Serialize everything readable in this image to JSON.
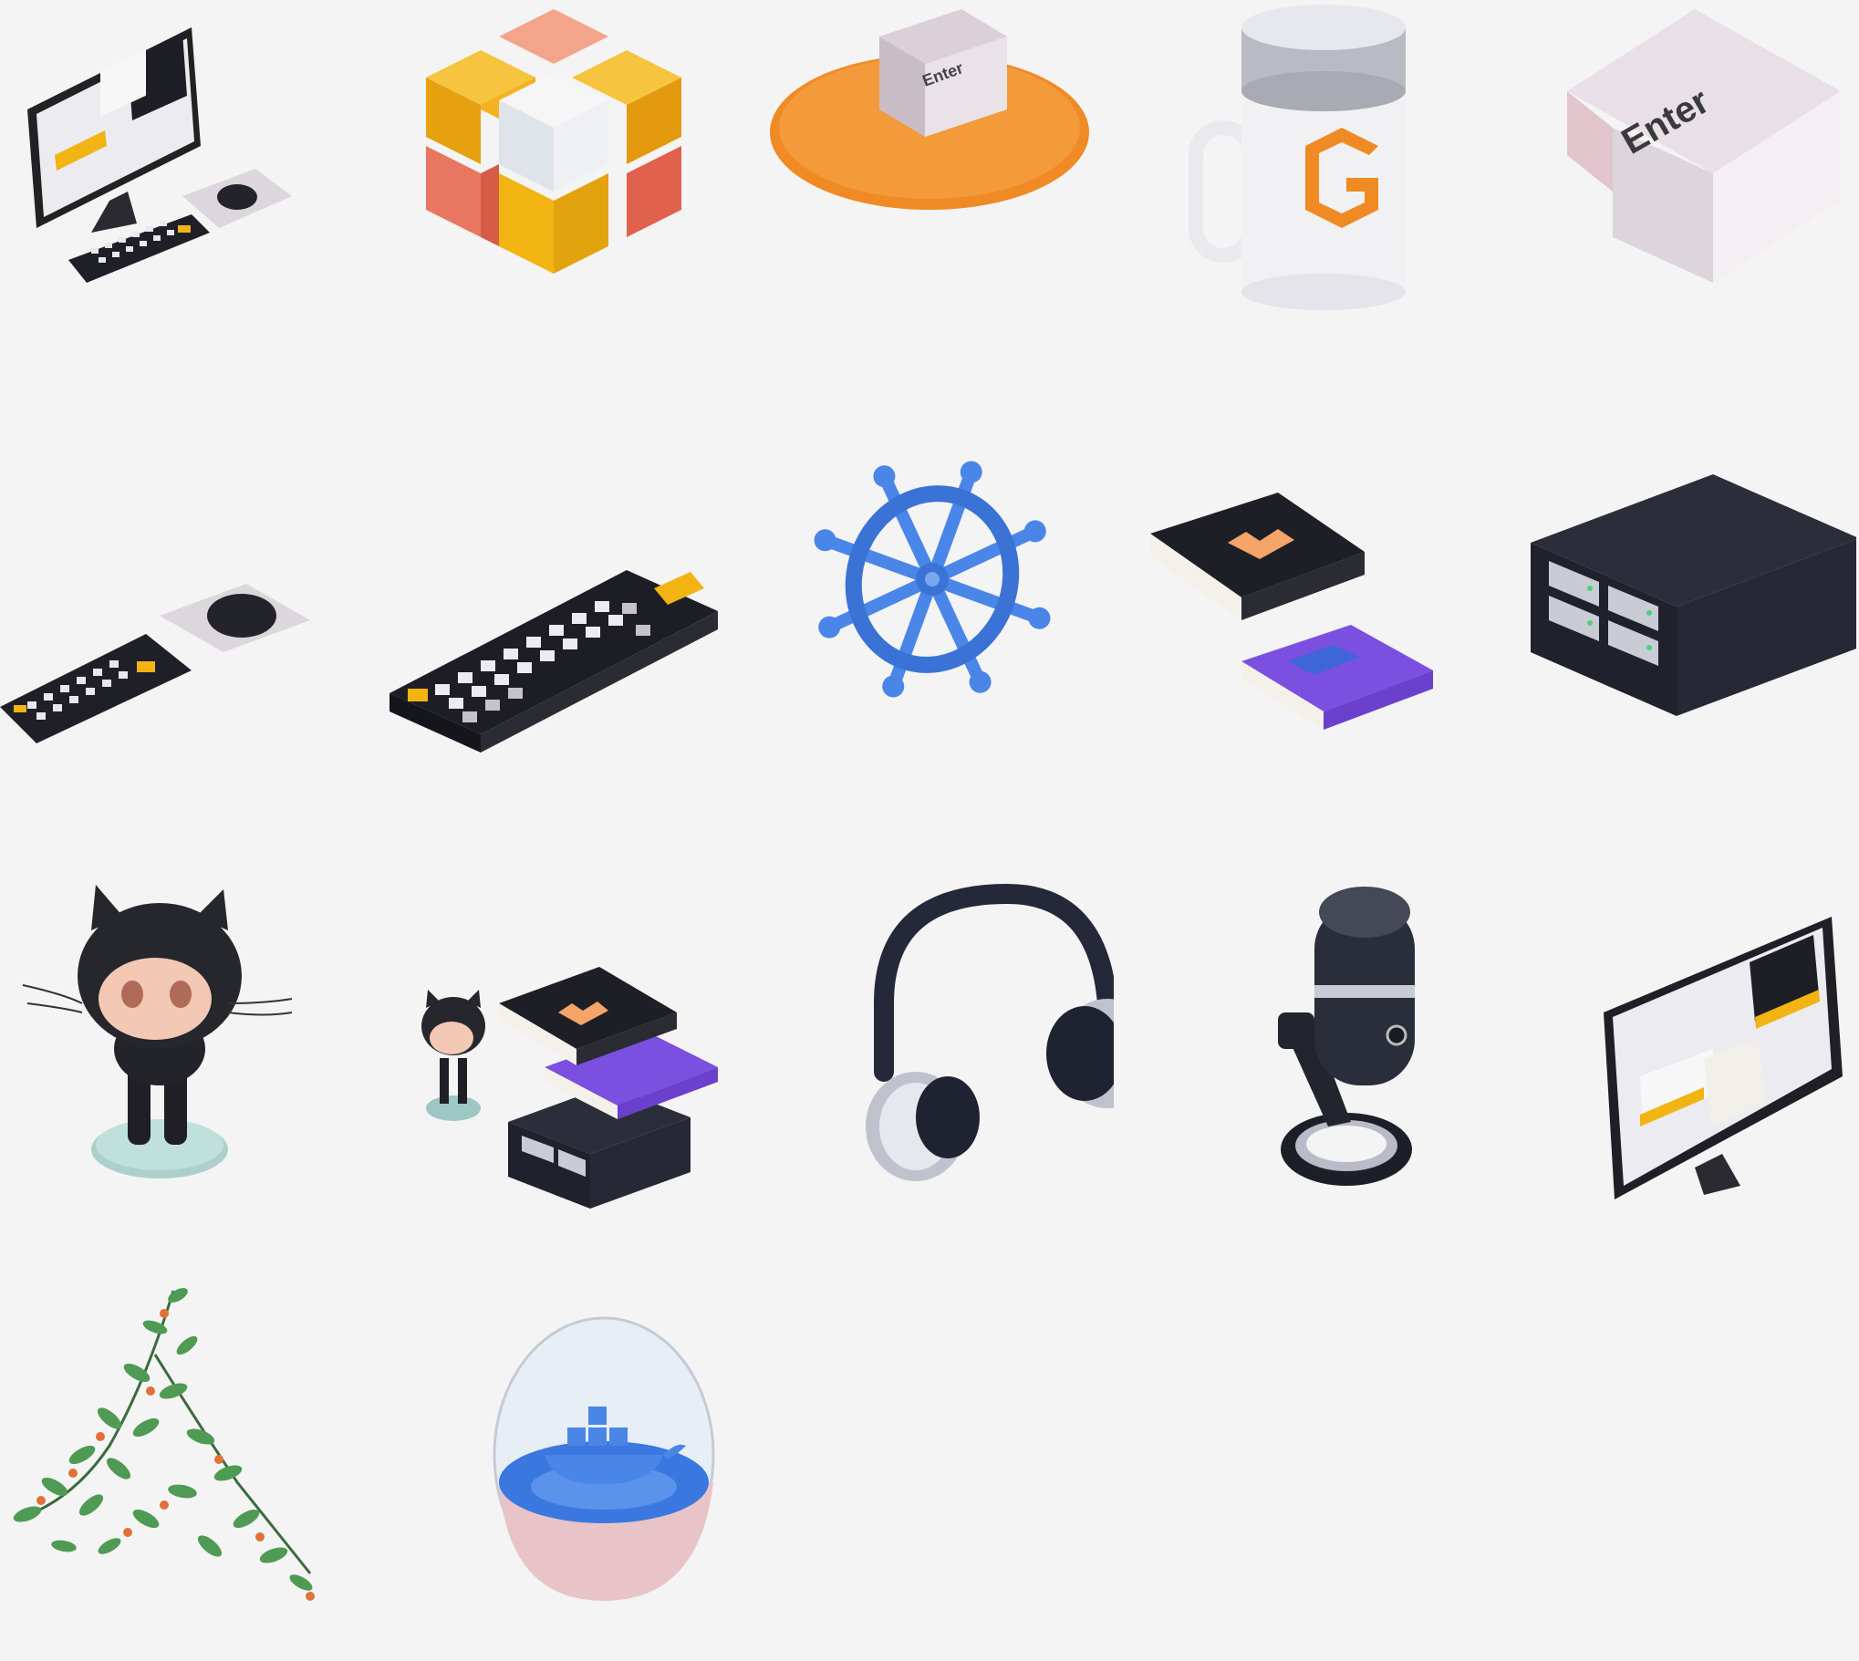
{
  "gallery": {
    "items": [
      {
        "name": "computer-setup-icon"
      },
      {
        "name": "rubiks-cube-icon"
      },
      {
        "name": "enter-key-on-rug-icon",
        "key_label": "Enter"
      },
      {
        "name": "gitpod-mug-icon"
      },
      {
        "name": "enter-key-icon",
        "key_label": "Enter"
      },
      {
        "name": "keyboard-and-mouse-icon"
      },
      {
        "name": "keyboard-icon"
      },
      {
        "name": "ship-wheel-icon"
      },
      {
        "name": "books-icon"
      },
      {
        "name": "server-icon"
      },
      {
        "name": "octocat-icon"
      },
      {
        "name": "octocat-books-server-icon"
      },
      {
        "name": "headphones-icon"
      },
      {
        "name": "microphone-icon"
      },
      {
        "name": "monitor-icon"
      },
      {
        "name": "plant-icon"
      },
      {
        "name": "docker-terrarium-icon"
      }
    ]
  },
  "colors": {
    "background": "#f4f4f4",
    "yellow": "#f2b413",
    "salmon": "#ea7c65",
    "dark": "#23262f",
    "blue": "#4a86e8",
    "purple": "#7b4fe0",
    "orange": "#f08a24"
  }
}
